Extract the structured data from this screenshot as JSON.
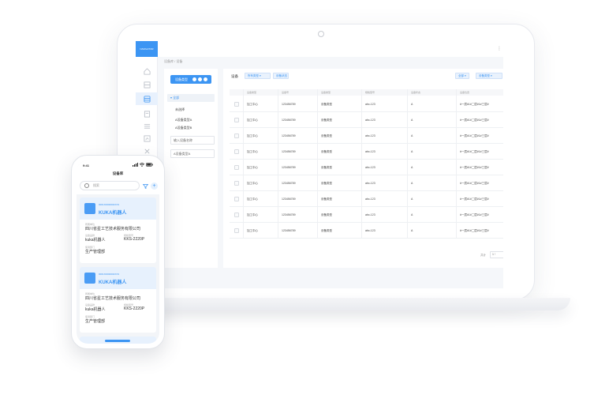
{
  "laptop": {
    "logo_text": "NAVIGATOR",
    "breadcrumb": "设备库 / 设备",
    "more_icon": "⋮",
    "tree": {
      "add_type_label": "设备类型",
      "selected_node": "全部",
      "items": [
        "未选择",
        "A设备类型A",
        "A设备类型B"
      ],
      "input_placeholder": "输入设备名称",
      "last_item": "A设备类型A"
    },
    "table_panel": {
      "title": "设备",
      "filter1": "所有类型",
      "filter2": "设备状态",
      "right_filter1": "全部",
      "right_filter2": "设备类型",
      "columns": [
        "",
        "设备类型",
        "设备号",
        "设备类型",
        "规格型号",
        "设备状态",
        "设备位置"
      ],
      "rows": [
        [
          "",
          "加工中心",
          "123456789",
          "设备类型",
          "abc-123",
          "A",
          "#一层#1#二层#1#三层#"
        ],
        [
          "",
          "加工中心",
          "123456789",
          "设备类型",
          "abc-123",
          "A",
          "#一层#1#二层#1#三层#"
        ],
        [
          "",
          "加工中心",
          "123456789",
          "设备类型",
          "abc-123",
          "A",
          "#一层#1#二层#1#三层#"
        ],
        [
          "",
          "加工中心",
          "123456789",
          "设备类型",
          "abc-123",
          "A",
          "#一层#1#二层#1#三层#"
        ],
        [
          "",
          "加工中心",
          "123456789",
          "设备类型",
          "abc-123",
          "A",
          "#一层#1#二层#1#三层#"
        ],
        [
          "",
          "加工中心",
          "123456789",
          "设备类型",
          "abc-123",
          "A",
          "#一层#1#二层#1#三层#"
        ],
        [
          "",
          "加工中心",
          "123456789",
          "设备类型",
          "abc-123",
          "A",
          "#一层#1#二层#1#三层#"
        ],
        [
          "",
          "加工中心",
          "123456789",
          "设备类型",
          "abc-123",
          "A",
          "#一层#1#二层#1#三层#"
        ],
        [
          "",
          "加工中心",
          "123456789",
          "设备类型",
          "abc-123",
          "A",
          "#一层#1#二层#1#三层#"
        ]
      ],
      "pager_label": "共计",
      "pager_value": "1"
    },
    "accent": "#3c95f3"
  },
  "phone": {
    "time": "9:41",
    "title": "设备库",
    "search_placeholder": "搜索",
    "cards": [
      {
        "code": "0001X0000004XX3",
        "name": "KUKA机器人",
        "org_label": "所属单位",
        "org": "四川省星工艺技术服务有限公司",
        "brand_label": "设备品牌",
        "brand": "kuka机器人",
        "model_label": "规格型号",
        "model": "KKS-2220P",
        "dept_label": "使用部门",
        "dept": "生产管理部"
      },
      {
        "code": "0001X0000004XX3",
        "name": "KUKA机器人",
        "org_label": "所属单位",
        "org": "四川省星工艺技术服务有限公司",
        "brand_label": "设备品牌",
        "brand": "kuka机器人",
        "model_label": "规格型号",
        "model": "KKS-2220P",
        "dept_label": "使用部门",
        "dept": "生产管理部"
      }
    ]
  }
}
